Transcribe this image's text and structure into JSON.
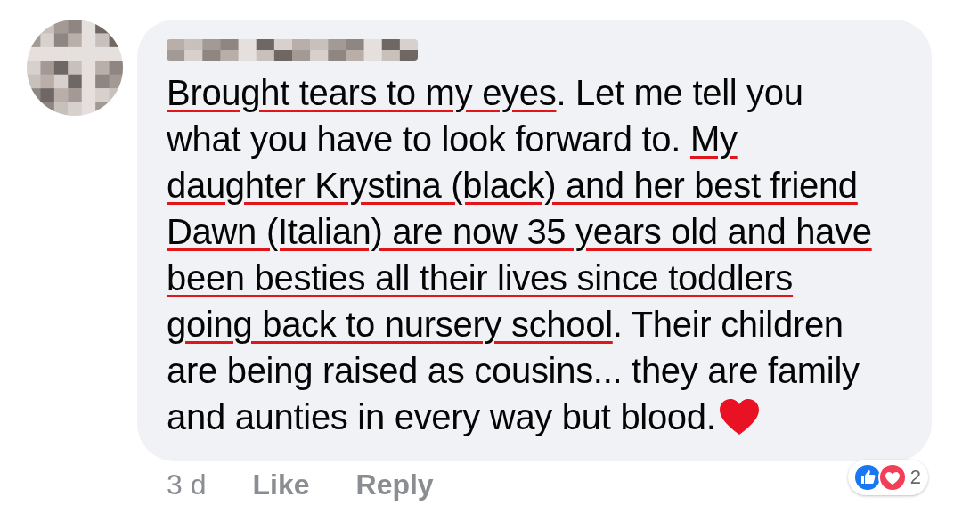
{
  "comment": {
    "author_blurred": true,
    "lines": [
      [
        {
          "text": "Brought tears to my eyes",
          "underlined": true
        },
        {
          "text": ". Let me tell you",
          "underlined": false
        }
      ],
      [
        {
          "text": "what you have to look forward to. ",
          "underlined": false
        },
        {
          "text": "My",
          "underlined": true
        }
      ],
      [
        {
          "text": "daughter Krystina (black) and her best friend",
          "underlined": true
        }
      ],
      [
        {
          "text": "Dawn (Italian) are now 35 years old and have",
          "underlined": true
        }
      ],
      [
        {
          "text": "been besties all their lives since toddlers",
          "underlined": true
        }
      ],
      [
        {
          "text": "going back to nursery school",
          "underlined": true
        },
        {
          "text": ". Their children",
          "underlined": false
        }
      ],
      [
        {
          "text": "are being raised as cousins... they are family",
          "underlined": false
        }
      ],
      [
        {
          "text": "and aunties in every way but blood.",
          "underlined": false
        }
      ]
    ],
    "time": "3 d",
    "actions": [
      "Like",
      "Reply"
    ],
    "reaction_count": "2"
  }
}
